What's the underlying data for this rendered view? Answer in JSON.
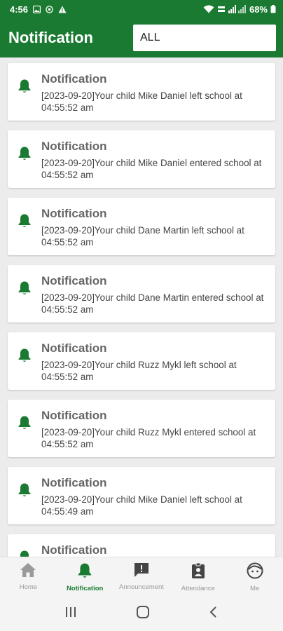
{
  "status_bar": {
    "time": "4:56",
    "battery": "68%"
  },
  "app_bar": {
    "title": "Notification",
    "filter_value": "ALL"
  },
  "notifications": [
    {
      "title": "Notification",
      "message": "[2023-09-20]Your child Mike Daniel left school at 04:55:52 am"
    },
    {
      "title": "Notification",
      "message": "[2023-09-20]Your child Mike Daniel entered school at 04:55:52 am"
    },
    {
      "title": "Notification",
      "message": "[2023-09-20]Your child Dane Martin left school at 04:55:52 am"
    },
    {
      "title": "Notification",
      "message": "[2023-09-20]Your child Dane Martin entered school at 04:55:52 am"
    },
    {
      "title": "Notification",
      "message": "[2023-09-20]Your child Ruzz Mykl left school at 04:55:52 am"
    },
    {
      "title": "Notification",
      "message": "[2023-09-20]Your child Ruzz Mykl entered school at 04:55:52 am"
    },
    {
      "title": "Notification",
      "message": "[2023-09-20]Your child Mike Daniel left school at 04:55:49 am"
    },
    {
      "title": "Notification",
      "message": ""
    }
  ],
  "bottom_nav": [
    {
      "label": "Home",
      "icon": "home-icon"
    },
    {
      "label": "Notification",
      "icon": "bell-icon",
      "active": true
    },
    {
      "label": "Announcement",
      "icon": "announcement-icon"
    },
    {
      "label": "Attendance",
      "icon": "attendance-icon"
    },
    {
      "label": "Me",
      "icon": "face-icon"
    }
  ],
  "colors": {
    "primary": "#1b7a31",
    "inactive": "#999999",
    "card_title": "#666666"
  }
}
